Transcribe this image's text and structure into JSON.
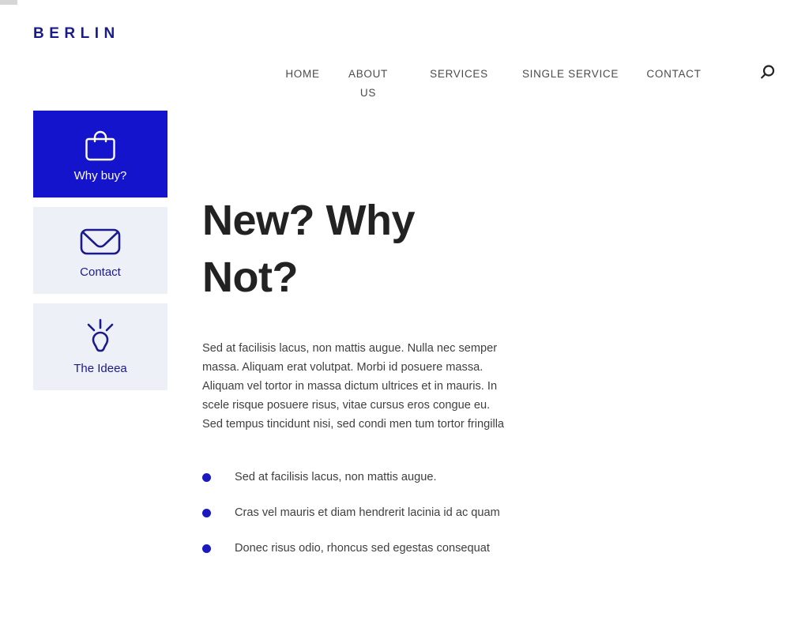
{
  "brand": {
    "name": "BERLIN"
  },
  "nav": {
    "items": [
      {
        "label": "HOME"
      },
      {
        "label": "ABOUT US"
      },
      {
        "label": "SERVICES"
      },
      {
        "label": "SINGLE SERVICE"
      },
      {
        "label": "CONTACT"
      }
    ],
    "search_icon": "search-icon"
  },
  "sidebar": {
    "cards": [
      {
        "label": "Why buy?",
        "icon": "shopping-bag-icon",
        "active": true
      },
      {
        "label": "Contact",
        "icon": "envelope-icon",
        "active": false
      },
      {
        "label": "The Ideea",
        "icon": "lightbulb-icon",
        "active": false
      }
    ]
  },
  "main": {
    "title": "New? Why Not?",
    "paragraph": "Sed at facilisis lacus, non mattis augue. Nulla nec semper massa. Aliquam erat volutpat. Morbi id posuere massa. Aliquam vel tortor in massa dictum ultrices et in mauris. In scele risque posuere risus, vitae cursus eros congue eu. Sed tempus tincidunt nisi, sed condi men tum tortor fringilla",
    "bullets": [
      {
        "text": "Sed at facilisis lacus, non mattis augue."
      },
      {
        "text": "Cras vel mauris et diam hendrerit lacinia id ac quam"
      },
      {
        "text": "Donec risus odio, rhoncus sed egestas consequat"
      }
    ]
  },
  "colors": {
    "brand_navy": "#1a1a8c",
    "accent_blue": "#1414cc",
    "card_bg": "#eef0f7",
    "heading": "#222222",
    "nav_text": "#4b4b4b"
  }
}
